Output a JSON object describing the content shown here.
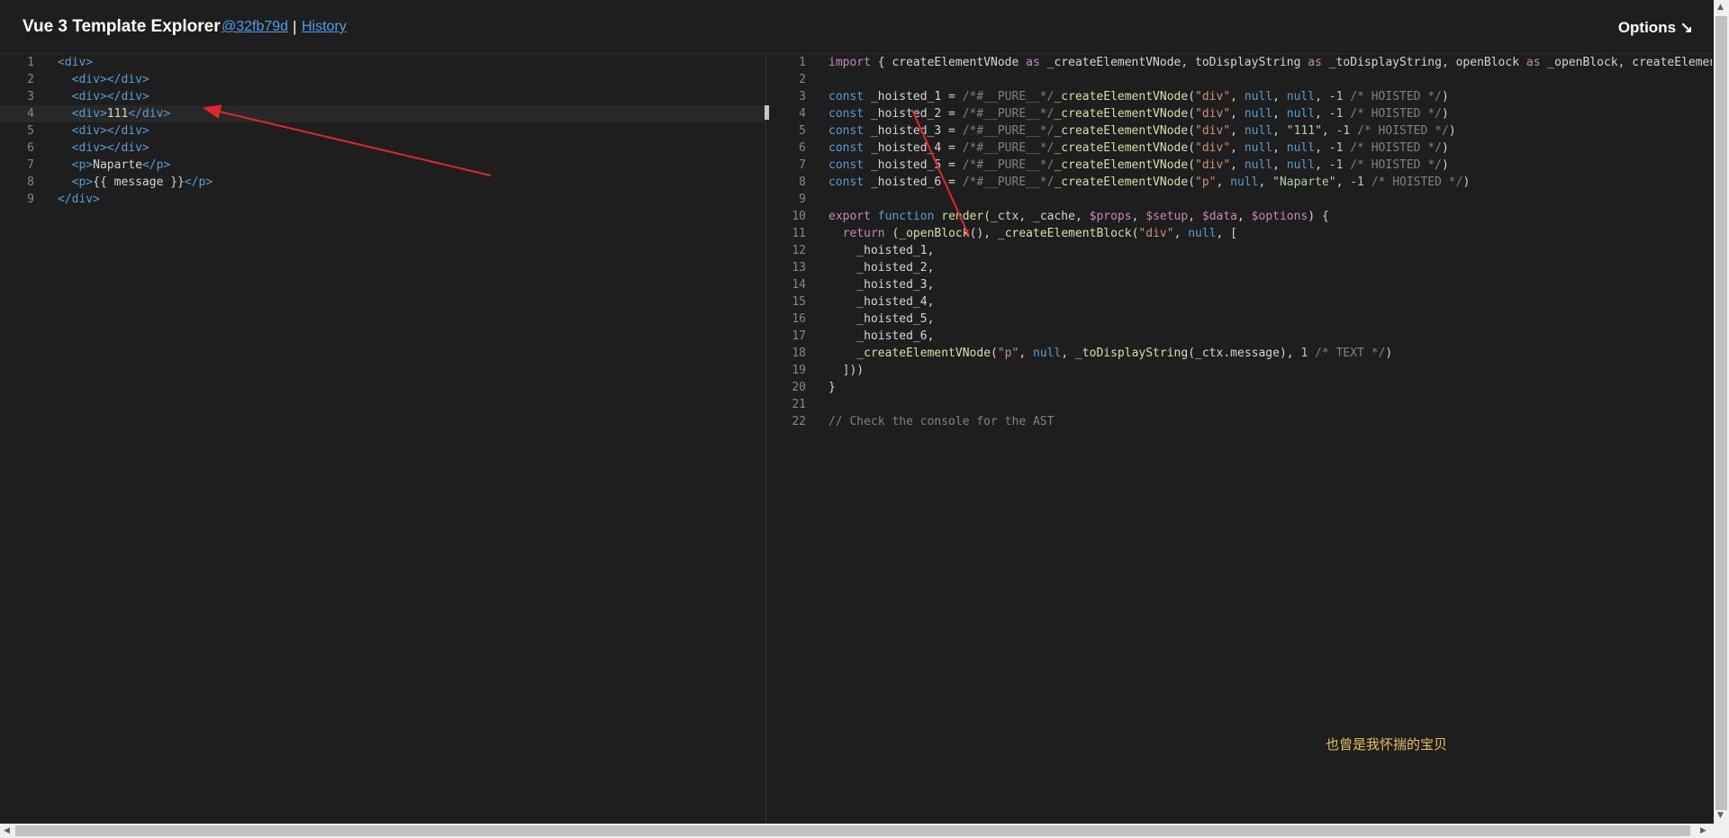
{
  "header": {
    "title": "Vue 3 Template Explorer",
    "commit": "@32fb79d",
    "separator": "|",
    "history": "History",
    "options": "Options ↘"
  },
  "source": {
    "lines": [
      {
        "n": "1",
        "html": "<span class='tag'>&lt;div&gt;</span>"
      },
      {
        "n": "2",
        "html": "  <span class='tag'>&lt;div&gt;&lt;/div&gt;</span>"
      },
      {
        "n": "3",
        "html": "  <span class='tag'>&lt;div&gt;&lt;/div&gt;</span>"
      },
      {
        "n": "4",
        "html": "  <span class='tag'>&lt;div&gt;</span><span class='txt'>111</span><span class='tag'>&lt;/div&gt;</span>"
      },
      {
        "n": "5",
        "html": "  <span class='tag'>&lt;div&gt;&lt;/div&gt;</span>"
      },
      {
        "n": "6",
        "html": "  <span class='tag'>&lt;div&gt;&lt;/div&gt;</span>"
      },
      {
        "n": "7",
        "html": "  <span class='tag'>&lt;p&gt;</span><span class='txt'>Naparte</span><span class='tag'>&lt;/p&gt;</span>"
      },
      {
        "n": "8",
        "html": "  <span class='tag'>&lt;p&gt;</span><span class='txt'>{{ message }}</span><span class='tag'>&lt;/p&gt;</span>"
      },
      {
        "n": "9",
        "html": "<span class='tag'>&lt;/div&gt;</span>"
      }
    ]
  },
  "output": {
    "lines": [
      {
        "n": "1",
        "html": "<span class='kw'>import</span> { createElementVNode <span class='kw'>as</span> _createElementVNode, toDisplayString <span class='kw'>as</span> _toDisplayString, openBlock <span class='kw'>as</span> _openBlock, createElementB"
      },
      {
        "n": "2",
        "html": ""
      },
      {
        "n": "3",
        "html": "<span class='kw2'>const</span> _hoisted_1 = <span class='cmt2'>/*#__PURE__*/</span><span class='fn'>_createElementVNode</span>(<span class='str'>\"div\"</span>, <span class='null'>null</span>, <span class='null'>null</span>, <span class='num'>-1</span> <span class='cmt2'>/* HOISTED */</span>)"
      },
      {
        "n": "4",
        "html": "<span class='kw2'>const</span> _hoisted_2 = <span class='cmt2'>/*#__PURE__*/</span><span class='fn'>_createElementVNode</span>(<span class='str'>\"div\"</span>, <span class='null'>null</span>, <span class='null'>null</span>, <span class='num'>-1</span> <span class='cmt2'>/* HOISTED */</span>)"
      },
      {
        "n": "5",
        "html": "<span class='kw2'>const</span> _hoisted_3 = <span class='cmt2'>/*#__PURE__*/</span><span class='fn'>_createElementVNode</span>(<span class='str'>\"div\"</span>, <span class='null'>null</span>, <span class='str2'>\"111\"</span>, <span class='num'>-1</span> <span class='cmt2'>/* HOISTED */</span>)"
      },
      {
        "n": "6",
        "html": "<span class='kw2'>const</span> _hoisted_4 = <span class='cmt2'>/*#__PURE__*/</span><span class='fn'>_createElementVNode</span>(<span class='str'>\"div\"</span>, <span class='null'>null</span>, <span class='null'>null</span>, <span class='num'>-1</span> <span class='cmt2'>/* HOISTED */</span>)"
      },
      {
        "n": "7",
        "html": "<span class='kw2'>const</span> _hoisted_5 = <span class='cmt2'>/*#__PURE__*/</span><span class='fn'>_createElementVNode</span>(<span class='str'>\"div\"</span>, <span class='null'>null</span>, <span class='null'>null</span>, <span class='num'>-1</span> <span class='cmt2'>/* HOISTED */</span>)"
      },
      {
        "n": "8",
        "html": "<span class='kw2'>const</span> _hoisted_6 = <span class='cmt2'>/*#__PURE__*/</span><span class='fn'>_createElementVNode</span>(<span class='str'>\"p\"</span>, <span class='null'>null</span>, <span class='str2'>\"Naparte\"</span>, <span class='num'>-1</span> <span class='cmt2'>/* HOISTED */</span>)"
      },
      {
        "n": "9",
        "html": ""
      },
      {
        "n": "10",
        "html": "<span class='kw'>export</span> <span class='kw2'>function</span> <span class='fn'>render</span>(_ctx, _cache, <span class='dollar'>$props</span>, <span class='dollar'>$setup</span>, <span class='dollar'>$data</span>, <span class='dollar'>$options</span>) {"
      },
      {
        "n": "11",
        "html": "  <span class='kw'>return</span> (<span class='fn'>_openBlock</span>(), <span class='fn'>_createElementBlock</span>(<span class='str'>\"div\"</span>, <span class='null'>null</span>, ["
      },
      {
        "n": "12",
        "html": "    _hoisted_1,"
      },
      {
        "n": "13",
        "html": "    _hoisted_2,"
      },
      {
        "n": "14",
        "html": "    _hoisted_3,"
      },
      {
        "n": "15",
        "html": "    _hoisted_4,"
      },
      {
        "n": "16",
        "html": "    _hoisted_5,"
      },
      {
        "n": "17",
        "html": "    _hoisted_6,"
      },
      {
        "n": "18",
        "html": "    <span class='fn'>_createElementVNode</span>(<span class='str'>\"p\"</span>, <span class='null'>null</span>, <span class='fn'>_toDisplayString</span>(_ctx.message), <span class='num'>1</span> <span class='cmt2'>/* TEXT */</span>)"
      },
      {
        "n": "19",
        "html": "  ]))"
      },
      {
        "n": "20",
        "html": "}"
      },
      {
        "n": "21",
        "html": ""
      },
      {
        "n": "22",
        "html": "<span class='cmt2'>// Check the console for the AST</span>"
      }
    ]
  },
  "subtitle": "也曾是我怀揣的宝贝",
  "colors": {
    "background": "#1e1e1e",
    "link": "#4d9ee8",
    "annotation_arrow": "#e0262b",
    "subtitle": "#e6c15a"
  }
}
